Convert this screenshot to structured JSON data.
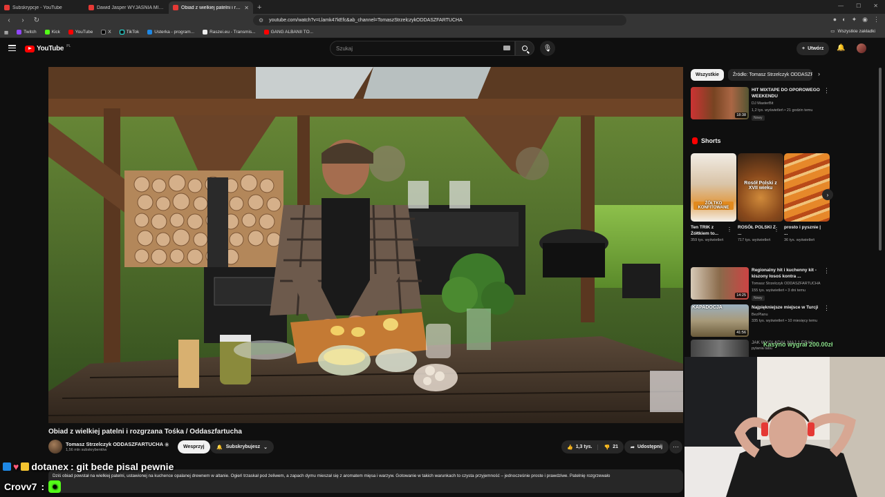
{
  "browser": {
    "tabs": [
      {
        "label": "Subskrypcje - YouTube",
        "active": false
      },
      {
        "label": "Dawid Jasper WYJAŚNIA MIKROCYPI",
        "active": false
      },
      {
        "label": "Obiad z wielkiej patelni i rozg",
        "active": true
      }
    ],
    "url": "youtube.com/watch?v=Llamk47kEfc&ab_channel=TomaszStrzelczykODDASZFARTUCHA",
    "bookmarks": [
      "Twitch",
      "Kick",
      "YouTube",
      "X",
      "TikTok",
      "Usterka - program...",
      "Raszei.eu - Transmis...",
      "GANG ALBANII TO..."
    ],
    "bookmarks_all": "Wszystkie zakładki"
  },
  "youtube": {
    "logo_text": "YouTube",
    "logo_region": "PL",
    "search_placeholder": "Szukaj",
    "create_label": "Utwórz"
  },
  "video": {
    "title": "Obiad z wielkiej patelni i rozgrzana Tośka / Oddaszfartucha",
    "channel": "Tomasz Strzelczyk ODDASZFARTUCHA",
    "subscribers": "1,56 mln subskrybentów",
    "support_label": "Wesprzyj",
    "subscribed_label": "Subskrybujesz",
    "likes": "1,3 tys.",
    "dislikes": "21",
    "share_label": "Udostępnij",
    "description": "Dziś obiad powstał na wielkiej patelni, ustawionej na kuchence opalanej drewnem w altanie. Ogień trzaskał pod żeliwem, a zapach dymu mieszał się z aromatem mięsa i warzyw. Gotowanie w takich warunkach to czysta przyjemność – jednocześnie proste i prawdziwe. Patelnię rozgrzewało"
  },
  "sidebar": {
    "chips": [
      "Wszystkie",
      "Źródło: Tomasz Strzelczyk ODDASZFARTUCHA"
    ],
    "top_rec": {
      "title": "HIT MIXTAPE DO OPOROWEGO WEEKENDU",
      "channel": "DJ MasterBit",
      "meta": "1,2 tys. wyświetleń • 21 godzin temu",
      "badge": "Nowy",
      "duration": "18:38"
    },
    "shorts_label": "Shorts",
    "shorts": [
      {
        "title": "Ten TRIK z Żółtkiem to...",
        "views": "359 tys. wyświetleń",
        "overlay": "ŻÓŁTKO KONFITOWANE"
      },
      {
        "title": "ROSÓŁ POLSKI Z ...",
        "views": "717 tys. wyświetleń",
        "overlay": "Rosół Polski z XVII wieku"
      },
      {
        "title": "prosto i pysznie | ...",
        "views": "36 tys. wyświetleń",
        "overlay": ""
      }
    ],
    "recs": [
      {
        "title": "Regionalny hit i kuchenny kit - kiszony łosoś kontra ...",
        "channel": "Tomasz Strzelczyk ODDASZFARTUCHA",
        "meta": "155 tys. wyświetleń • 3 dni temu",
        "badge": "Nowy",
        "duration": "14:25"
      },
      {
        "title": "Najpiękniejsze miejsce w Turcji",
        "channel": "BezPlanu",
        "meta": "335 tys. wyświetleń • 10 miesięcy temu",
        "badge": "",
        "duration": "41:56",
        "overlay": "KAPADOCJA"
      },
      {
        "title": "JAK WYGLĄDAŁ MAJ 1 ERA?",
        "channel": "pytania tabu",
        "meta": "",
        "badge": "",
        "duration": ""
      }
    ]
  },
  "overlay": {
    "donation": "Kasyno wygrał 200.00zł",
    "chat": [
      {
        "user": "dotanex",
        "message": ": git bede pisal pewnie"
      },
      {
        "user": "Crovv7",
        "message": ":"
      }
    ]
  },
  "colors": {
    "bg": "#0f0f0f",
    "brand": "#ff0000",
    "chip": "#272727",
    "kick": "#53fc18"
  }
}
